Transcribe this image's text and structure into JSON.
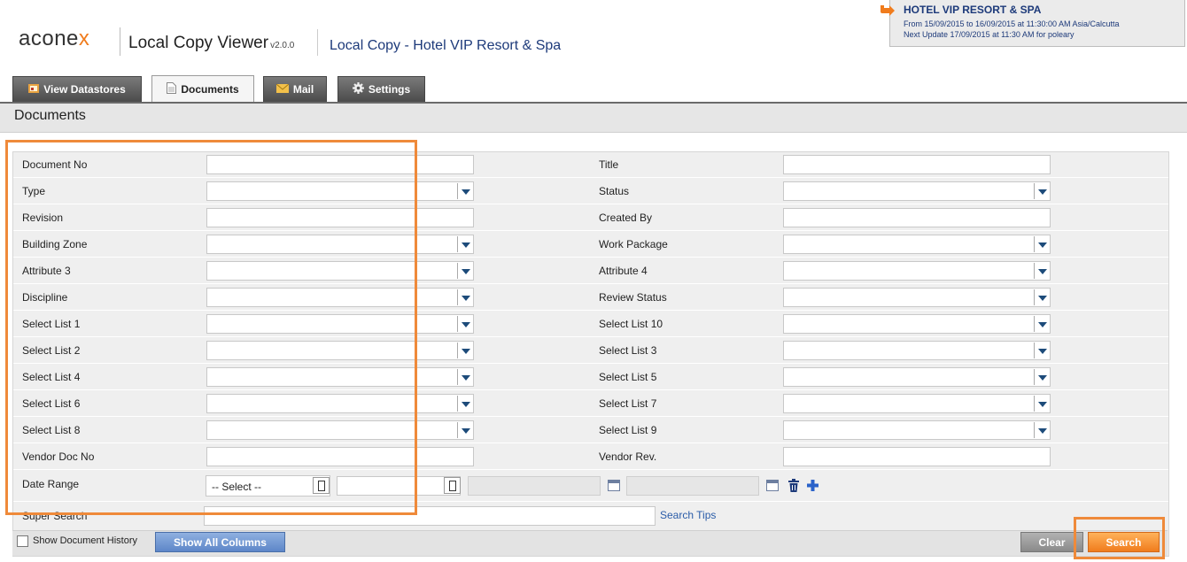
{
  "header": {
    "logo_main": "acone",
    "logo_x": "x",
    "app_title": "Local Copy Viewer",
    "app_version": "v2.0.0",
    "project_title": "Local Copy - Hotel VIP Resort & Spa"
  },
  "project_box": {
    "name": "HOTEL VIP RESORT & SPA",
    "line1": "From 15/09/2015 to 16/09/2015 at 11:30:00 AM Asia/Calcutta",
    "line2": "Next Update 17/09/2015 at 11:30 AM for poleary"
  },
  "tabs": [
    {
      "label": "View  Datastores",
      "icon": "datastore-icon"
    },
    {
      "label": "Documents",
      "icon": "document-icon"
    },
    {
      "label": "Mail",
      "icon": "mail-icon"
    },
    {
      "label": "Settings",
      "icon": "gear-icon"
    }
  ],
  "section_title": "Documents",
  "form": {
    "left_labels": [
      "Document No",
      "Type",
      "Revision",
      "Building Zone",
      "Attribute 3",
      "Discipline",
      "Select List 1",
      "Select List 2",
      "Select List 4",
      "Select List 6",
      "Select List 8",
      "Vendor Doc No"
    ],
    "right_labels": [
      "Title",
      "Status",
      "Created By",
      "Work Package",
      "Attribute 4",
      "Review Status",
      "Select List 10",
      "Select List 3",
      "Select List 5",
      "Select List 7",
      "Select List 9",
      "Vendor Rev."
    ],
    "date_range_label": "Date Range",
    "date_select_value": "-- Select --",
    "super_search_label": "Super Search",
    "search_tips": "Search Tips"
  },
  "footer": {
    "show_history_label": "Show Document History",
    "show_all_columns": "Show All Columns",
    "clear": "Clear",
    "search": "Search"
  },
  "colors": {
    "accent": "#f07c1d",
    "brand_blue": "#1d3a7a",
    "highlight": "#ef8a3a"
  }
}
